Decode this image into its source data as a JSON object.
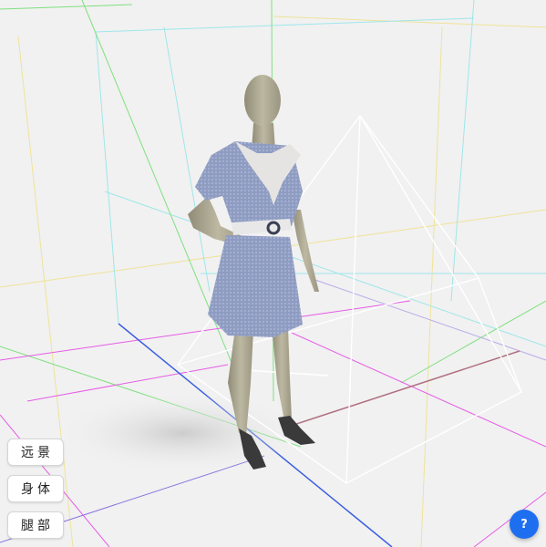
{
  "view_buttons": {
    "far": "远景",
    "body": "身体",
    "legs": "腿部"
  },
  "help": {
    "label": "?"
  },
  "colors": {
    "background": "#f1f1f1",
    "help_button": "#1e6ff0",
    "dress": "#8c9ac0",
    "collar": "#e6e4e2",
    "mannequin": "#b6b19a",
    "grid_green": "#7fe07f",
    "grid_magenta": "#e65ce6",
    "grid_blue": "#3b5fe0",
    "grid_yellow": "#efe39a",
    "grid_cyan": "#9fe6ea",
    "light_helper": "#ffffff"
  },
  "icons": {
    "help": "question-mark-icon"
  }
}
